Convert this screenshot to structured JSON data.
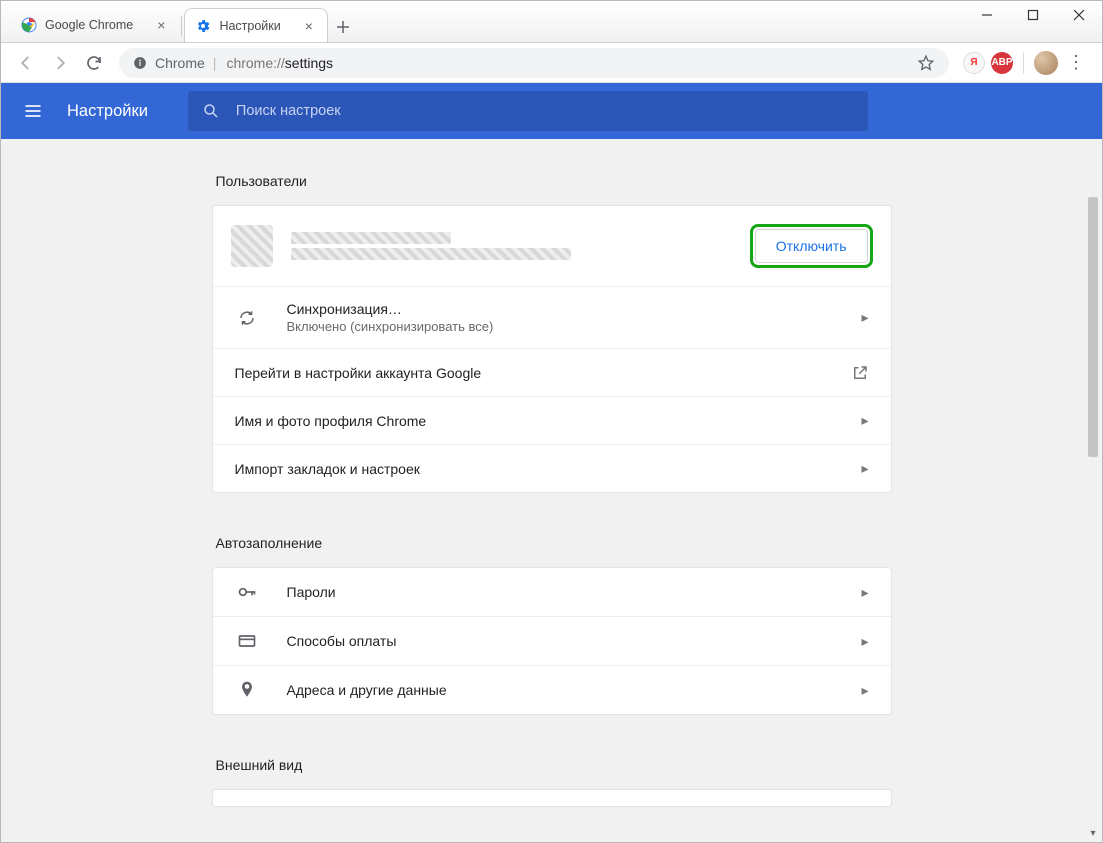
{
  "window": {
    "tabs": [
      {
        "title": "Google Chrome",
        "icon": "chrome-icon",
        "active": false
      },
      {
        "title": "Настройки",
        "icon": "gear-icon",
        "active": true
      }
    ]
  },
  "omnibar": {
    "secure_label": "Chrome",
    "url_proto": "chrome://",
    "url_path": "settings"
  },
  "header": {
    "title": "Настройки",
    "search_placeholder": "Поиск настроек"
  },
  "sections": {
    "users": {
      "title": "Пользователи",
      "disconnect_label": "Отключить",
      "sync": {
        "title": "Синхронизация…",
        "subtitle": "Включено (синхронизировать все)"
      },
      "account_settings": "Перейти в настройки аккаунта Google",
      "name_photo": "Имя и фото профиля Chrome",
      "import": "Импорт закладок и настроек"
    },
    "autofill": {
      "title": "Автозаполнение",
      "passwords": "Пароли",
      "payments": "Способы оплаты",
      "addresses": "Адреса и другие данные"
    },
    "appearance": {
      "title": "Внешний вид"
    }
  }
}
